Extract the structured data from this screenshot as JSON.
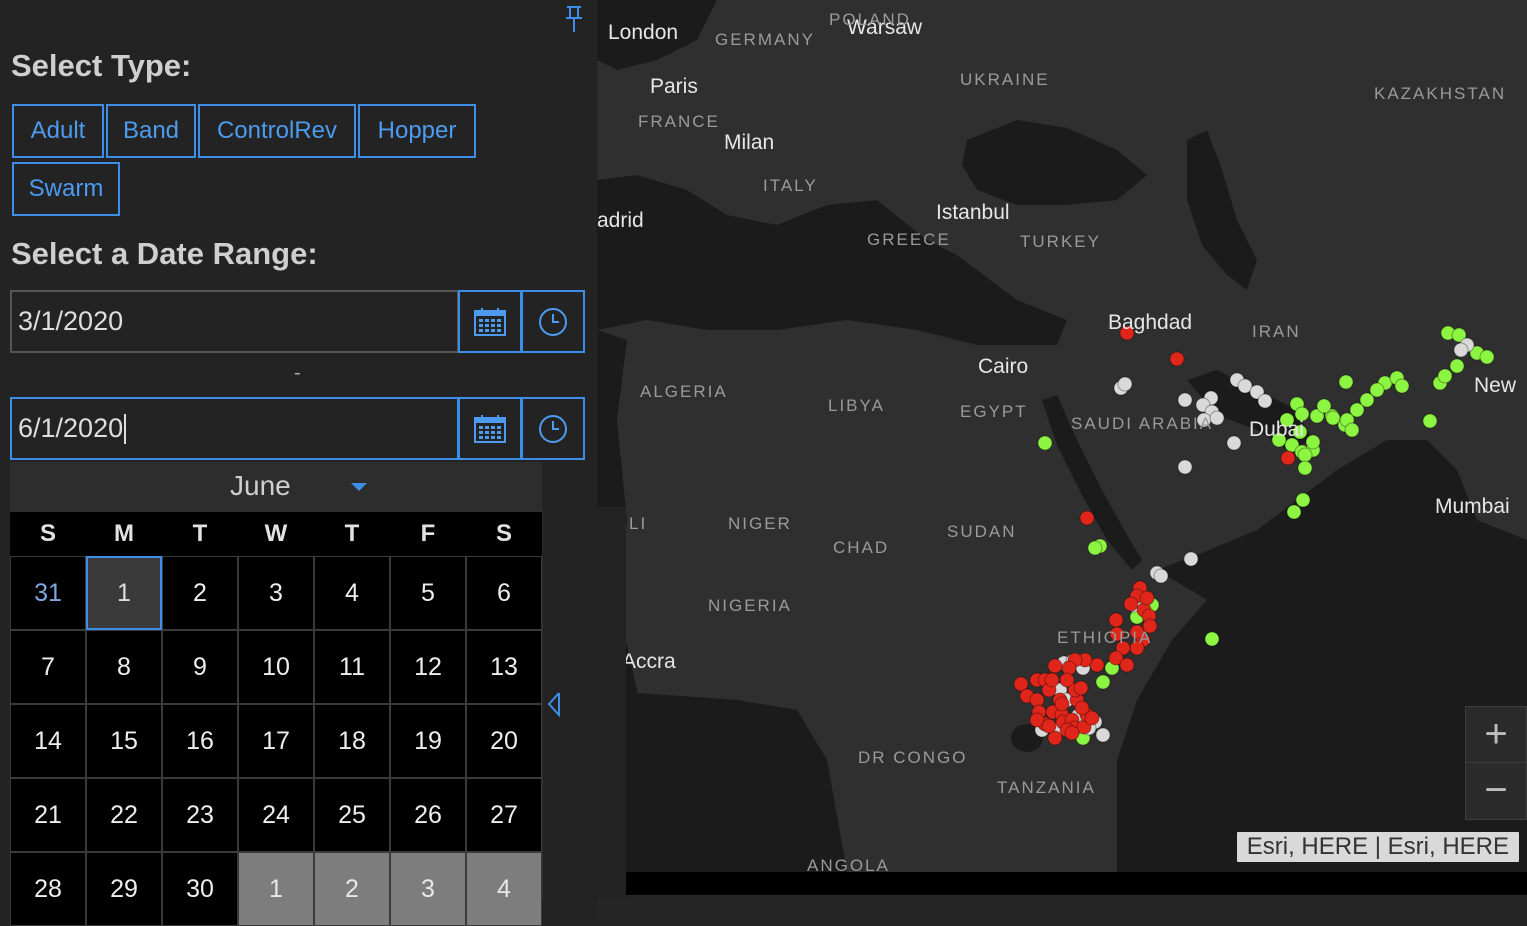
{
  "panel": {
    "type_heading": "Select Type:",
    "type_buttons": [
      "Adult",
      "Band",
      "ControlRev",
      "Hopper",
      "Swarm"
    ],
    "date_heading": "Select a Date Range:",
    "start_date": "3/1/2020",
    "range_separator": "-",
    "end_date": "6/1/2020",
    "icons": {
      "pin": "pin-icon",
      "calendar": "calendar-icon",
      "clock": "clock-icon",
      "collapse": "collapse-left-icon"
    }
  },
  "calendar": {
    "month": "June",
    "weekdays": [
      "S",
      "M",
      "T",
      "W",
      "T",
      "F",
      "S"
    ],
    "days": [
      "31",
      "1",
      "2",
      "3",
      "4",
      "5",
      "6",
      "7",
      "8",
      "9",
      "10",
      "11",
      "12",
      "13",
      "14",
      "15",
      "16",
      "17",
      "18",
      "19",
      "20",
      "21",
      "22",
      "23",
      "24",
      "25",
      "26",
      "27",
      "28",
      "29",
      "30",
      "1",
      "2",
      "3",
      "4"
    ],
    "selected_day": "1"
  },
  "map": {
    "cities": [
      "London",
      "Warsaw",
      "Paris",
      "Milan",
      "adrid",
      "Istanbul",
      "Baghdad",
      "Cairo",
      "Dubai",
      "New",
      "Mumbai",
      "Accra"
    ],
    "countries": [
      "GERMANY",
      "POLAND",
      "UKRAINE",
      "KAZAKHSTAN",
      "FRANCE",
      "ITALY",
      "GREECE",
      "TURKEY",
      "IRAN",
      "ALGERIA",
      "LIBYA",
      "EGYPT",
      "SAUDI ARABIA",
      "NIGER",
      "CHAD",
      "SUDAN",
      "NIGERIA",
      "ETHIOPIA",
      "DR CONGO",
      "TANZANIA",
      "ANGOLA",
      "LI"
    ],
    "zoom_in": "+",
    "zoom_out": "−",
    "attribution": "Esri, HERE | Esri, HERE",
    "colors": {
      "land": "#2f2f2f",
      "water": "#1b1b1b",
      "green": "#8cf542",
      "red": "#e0261b",
      "white": "#d9d9d9",
      "accent": "#3d8ee8"
    }
  }
}
